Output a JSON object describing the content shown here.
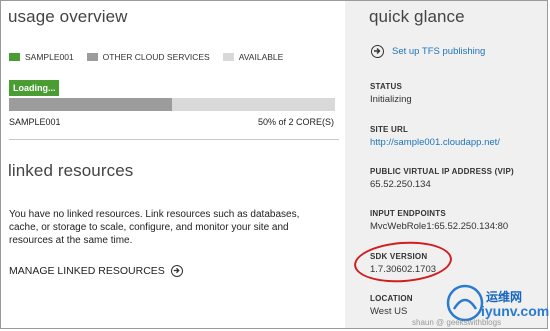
{
  "usage": {
    "title": "usage overview",
    "legend": [
      {
        "label": "SAMPLE001",
        "color": "#4a9d32"
      },
      {
        "label": "OTHER CLOUD SERVICES",
        "color": "#9c9c9c"
      },
      {
        "label": "AVAILABLE",
        "color": "#d9d9d9"
      }
    ],
    "loading": "Loading...",
    "bar": {
      "name": "SAMPLE001",
      "value_text": "50% of 2 CORE(S)",
      "fraction": 0.5
    }
  },
  "linked": {
    "title": "linked resources",
    "description": "You have no linked resources. Link resources such as databases, cache, or storage to scale, configure, and monitor your site and resources at the same time.",
    "manage_label": "MANAGE LINKED RESOURCES"
  },
  "glance": {
    "title": "quick glance",
    "tfs_link": "Set up TFS publishing",
    "fields": [
      {
        "label": "STATUS",
        "value": "Initializing"
      },
      {
        "label": "SITE URL",
        "value": "http://sample001.cloudapp.net/"
      },
      {
        "label": "PUBLIC VIRTUAL IP ADDRESS (VIP)",
        "value": "65.52.250.134"
      },
      {
        "label": "INPUT ENDPOINTS",
        "value": "MvcWebRole1:65.52.250.134:80"
      },
      {
        "label": "SDK VERSION",
        "value": "1.7.30602.1703"
      },
      {
        "label": "LOCATION",
        "value": "West US"
      }
    ]
  },
  "watermark": {
    "line1": "运维网",
    "line2": "iyunv.com",
    "blog": "shaun @ geekswithblogs"
  },
  "colors": {
    "annotation": "#d11d1d",
    "link": "#1f74b8"
  }
}
